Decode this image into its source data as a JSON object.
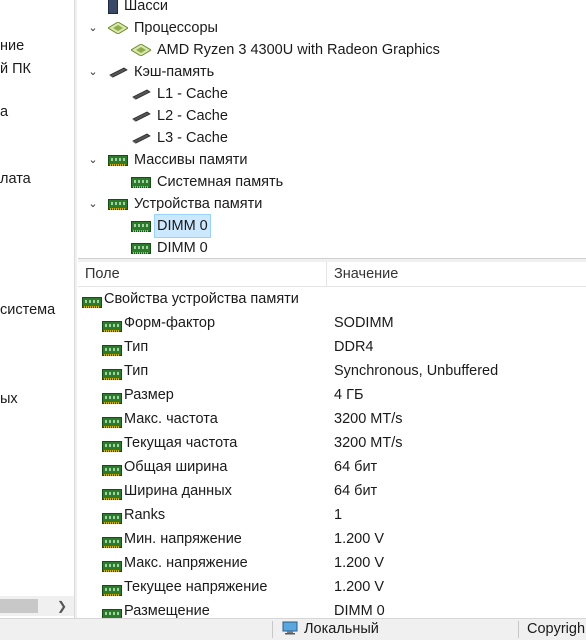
{
  "left_panel": {
    "items": [
      "ние",
      "й ПК",
      "а",
      "лата",
      "система",
      "ых"
    ]
  },
  "tree": {
    "items": [
      {
        "label": "Шасси",
        "icon": "chassis-icon",
        "level": 1,
        "expander": ""
      },
      {
        "label": "Процессоры",
        "icon": "cpu-icon",
        "level": 1,
        "expander": "⌄"
      },
      {
        "label": "AMD Ryzen 3 4300U with Radeon Graphics",
        "icon": "cpu-icon",
        "level": 2,
        "expander": ""
      },
      {
        "label": "Кэш-память",
        "icon": "cache-icon",
        "level": 1,
        "expander": "⌄"
      },
      {
        "label": "L1 - Cache",
        "icon": "cache-icon",
        "level": 2,
        "expander": ""
      },
      {
        "label": "L2 - Cache",
        "icon": "cache-icon",
        "level": 2,
        "expander": ""
      },
      {
        "label": "L3 - Cache",
        "icon": "cache-icon",
        "level": 2,
        "expander": ""
      },
      {
        "label": "Массивы памяти",
        "icon": "memory-icon",
        "level": 1,
        "expander": "⌄"
      },
      {
        "label": "Системная память",
        "icon": "memory-icon",
        "level": 2,
        "expander": ""
      },
      {
        "label": "Устройства памяти",
        "icon": "memory-icon",
        "level": 1,
        "expander": "⌄"
      },
      {
        "label": "DIMM 0",
        "icon": "memory-icon",
        "level": 2,
        "expander": "",
        "selected": true
      },
      {
        "label": "DIMM 0",
        "icon": "memory-icon",
        "level": 2,
        "expander": ""
      }
    ]
  },
  "properties": {
    "col_field": "Поле",
    "col_value": "Значение",
    "group_title": "Свойства устройства памяти",
    "rows": [
      {
        "name": "Форм-фактор",
        "value": "SODIMM"
      },
      {
        "name": "Тип",
        "value": "DDR4"
      },
      {
        "name": "Тип",
        "value": "Synchronous, Unbuffered"
      },
      {
        "name": "Размер",
        "value": "4 ГБ"
      },
      {
        "name": "Макс. частота",
        "value": "3200 MT/s"
      },
      {
        "name": "Текущая частота",
        "value": "3200 MT/s"
      },
      {
        "name": "Общая ширина",
        "value": "64 бит"
      },
      {
        "name": "Ширина данных",
        "value": "64 бит"
      },
      {
        "name": "Ranks",
        "value": "1"
      },
      {
        "name": "Мин. напряжение",
        "value": "1.200 V"
      },
      {
        "name": "Макс. напряжение",
        "value": "1.200 V"
      },
      {
        "name": "Текущее напряжение",
        "value": "1.200 V"
      },
      {
        "name": "Размещение",
        "value": "DIMM 0"
      }
    ]
  },
  "status_bar": {
    "local_label": "Локальный",
    "copyright_label": "Copyrigh"
  }
}
